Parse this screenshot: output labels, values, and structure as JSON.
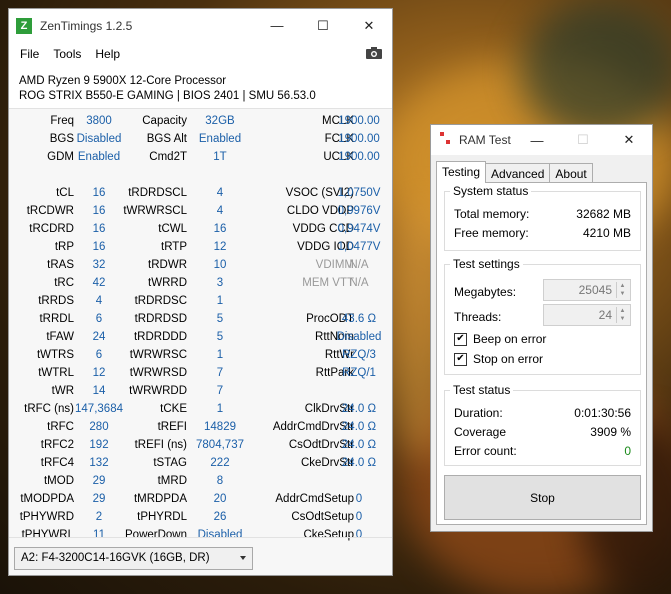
{
  "zentimings": {
    "title": "ZenTimings 1.2.5",
    "logo_letter": "Z",
    "menu": [
      "File",
      "Tools",
      "Help"
    ],
    "cpu": "AMD Ryzen 9 5900X 12-Core Processor",
    "board": "ROG STRIX B550-E GAMING | BIOS 2401 | SMU 56.53.0",
    "rows": [
      {
        "l1": "Freq",
        "v1": "3800",
        "l2": "Capacity",
        "v2": "32GB",
        "l3": "MCLK",
        "v3": "1900.00"
      },
      {
        "l1": "BGS",
        "v1": "Disabled",
        "l2": "BGS Alt",
        "v2": "Enabled",
        "l3": "FCLK",
        "v3": "1900.00"
      },
      {
        "l1": "GDM",
        "v1": "Enabled",
        "l2": "Cmd2T",
        "v2": "1T",
        "l3": "UCLK",
        "v3": "1900.00"
      },
      {
        "l1": "",
        "v1": "",
        "l2": "",
        "v2": "",
        "l3": "",
        "v3": ""
      },
      {
        "l1": "tCL",
        "v1": "16",
        "l2": "tRDRDSCL",
        "v2": "4",
        "l3": "VSOC (SVI2)",
        "v3": "1,0750V"
      },
      {
        "l1": "tRCDWR",
        "v1": "16",
        "l2": "tWRWRSCL",
        "v2": "4",
        "l3": "CLDO VDDP",
        "v3": "0,9976V"
      },
      {
        "l1": "tRCDRD",
        "v1": "16",
        "l2": "tCWL",
        "v2": "16",
        "l3": "VDDG CCD",
        "v3": "0,9474V"
      },
      {
        "l1": "tRP",
        "v1": "16",
        "l2": "tRTP",
        "v2": "12",
        "l3": "VDDG IOD",
        "v3": "1,0477V"
      },
      {
        "l1": "tRAS",
        "v1": "32",
        "l2": "tRDWR",
        "v2": "10",
        "l3": "VDIMM",
        "v3": "N/A",
        "muted": true
      },
      {
        "l1": "tRC",
        "v1": "42",
        "l2": "tWRRD",
        "v2": "3",
        "l3": "MEM VTT",
        "v3": "N/A",
        "muted": true
      },
      {
        "l1": "tRRDS",
        "v1": "4",
        "l2": "tRDRDSC",
        "v2": "1",
        "l3": "",
        "v3": ""
      },
      {
        "l1": "tRRDL",
        "v1": "6",
        "l2": "tRDRDSD",
        "v2": "5",
        "l3": "ProcODT",
        "v3": "43.6 Ω"
      },
      {
        "l1": "tFAW",
        "v1": "24",
        "l2": "tRDRDDD",
        "v2": "5",
        "l3": "RttNom",
        "v3": "Disabled"
      },
      {
        "l1": "tWTRS",
        "v1": "6",
        "l2": "tWRWRSC",
        "v2": "1",
        "l3": "RttWr",
        "v3": "RZQ/3"
      },
      {
        "l1": "tWTRL",
        "v1": "12",
        "l2": "tWRWRSD",
        "v2": "7",
        "l3": "RttPark",
        "v3": "RZQ/1"
      },
      {
        "l1": "tWR",
        "v1": "14",
        "l2": "tWRWRDD",
        "v2": "7",
        "l3": "",
        "v3": ""
      },
      {
        "l1": "tRFC (ns)",
        "v1": "147,3684",
        "l2": "tCKE",
        "v2": "1",
        "l3": "ClkDrvStr",
        "v3": "24.0 Ω"
      },
      {
        "l1": "tRFC",
        "v1": "280",
        "l2": "tREFI",
        "v2": "14829",
        "l3": "AddrCmdDrvStr",
        "v3": "24.0 Ω"
      },
      {
        "l1": "tRFC2",
        "v1": "192",
        "l2": "tREFI (ns)",
        "v2": "7804,737",
        "l3": "CsOdtDrvStr",
        "v3": "24.0 Ω"
      },
      {
        "l1": "tRFC4",
        "v1": "132",
        "l2": "tSTAG",
        "v2": "222",
        "l3": "CkeDrvStr",
        "v3": "24.0 Ω"
      },
      {
        "l1": "tMOD",
        "v1": "29",
        "l2": "tMRD",
        "v2": "8",
        "l3": "",
        "v3": ""
      },
      {
        "l1": "tMODPDA",
        "v1": "29",
        "l2": "tMRDPDA",
        "v2": "20",
        "l3": "AddrCmdSetup",
        "v3": "0"
      },
      {
        "l1": "tPHYWRD",
        "v1": "2",
        "l2": "tPHYRDL",
        "v2": "26",
        "l3": "CsOdtSetup",
        "v3": "0"
      },
      {
        "l1": "tPHYWRL",
        "v1": "11",
        "l2": "PowerDown",
        "v2": "Disabled",
        "l3": "CkeSetup",
        "v3": "0"
      }
    ],
    "module": "A2: F4-3200C14-16GVK (16GB, DR)"
  },
  "ramtest": {
    "title": "RAM Test",
    "tabs": [
      "Testing",
      "Advanced",
      "About"
    ],
    "system_status": {
      "title": "System status",
      "total_label": "Total memory:",
      "total_value": "32682 MB",
      "free_label": "Free memory:",
      "free_value": "4210 MB"
    },
    "test_settings": {
      "title": "Test settings",
      "mb_label": "Megabytes:",
      "mb_value": "25045",
      "threads_label": "Threads:",
      "threads_value": "24",
      "beep_label": "Beep on error",
      "beep_checked": true,
      "stop_label": "Stop on error",
      "stop_checked": true
    },
    "test_status": {
      "title": "Test status",
      "duration_label": "Duration:",
      "duration_value": "0:01:30:56",
      "coverage_label": "Coverage",
      "coverage_value": "3909 %",
      "errors_label": "Error count:",
      "errors_value": "0"
    },
    "stop_button": "Stop"
  },
  "colors": {
    "value_blue": "#1b5fa8",
    "error_green": "#1a8a1a",
    "logo_green": "#2e9d3a"
  }
}
